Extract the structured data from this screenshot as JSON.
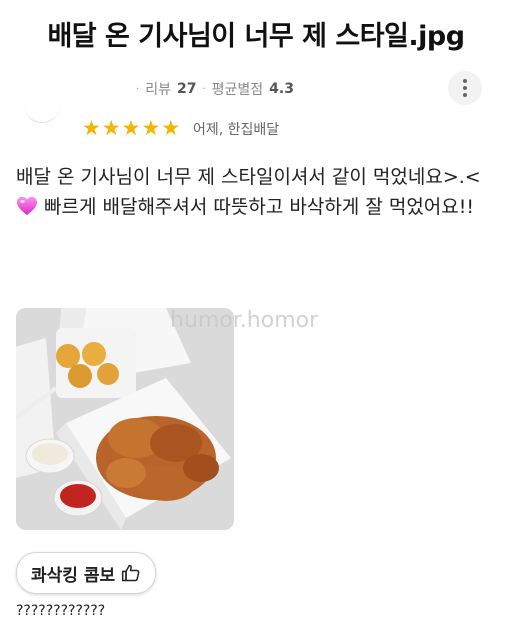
{
  "post_title": "배달 온 기사님이 너무 제 스타일.jpg",
  "review_meta": {
    "reviews_label": "리뷰",
    "reviews_count": "27",
    "separator": "·",
    "avg_label": "평균별점",
    "avg_value": "4.3"
  },
  "rating": {
    "stars": 5,
    "max": 5,
    "star_color": "#f5b400"
  },
  "date_text": "어제, 한집배달",
  "review_text": {
    "line1": "배달 온 기사님이 너무 제 스타일이셔서 같이 먹었네요>.<",
    "line2": "빠르게 배달해주셔서 따뜻하고 바삭하게 잘 먹었어요!!"
  },
  "watermark": "humor.homor",
  "menu_tag": {
    "label": "콰삭킹 콤보",
    "icon": "thumbs-up-icon"
  },
  "caption": "????????????",
  "colors": {
    "heart": "#e23bd3",
    "star": "#f5b400"
  }
}
